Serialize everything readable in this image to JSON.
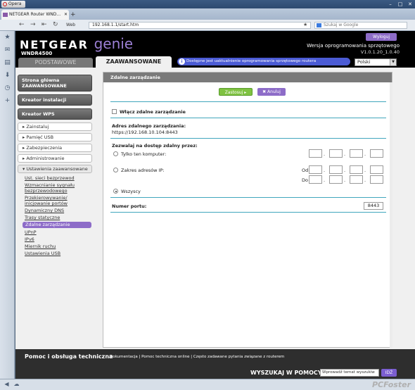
{
  "browser": {
    "menu_label": "Opera",
    "tab_title": "NETGEAR Router WND...",
    "web_label": "Web",
    "url": "192.168.1.1/start.htm",
    "search_placeholder": "Szukaj w Google",
    "watermark": "PCFoster"
  },
  "header": {
    "brand": "NETGEAR",
    "product": "genie",
    "model": "WNDR4500",
    "logout_label": "Wyloguj",
    "firmware_label": "Wersja oprogramowania sprzętowego",
    "firmware_version": "V1.0.1.20_1.0.40",
    "tab_basic": "PODSTAWOWE",
    "tab_advanced": "ZAAWANSOWANE",
    "update_notice": "Dostępne jest uaktualnienie oprogramowania sprzętowego routera",
    "language": "Polski"
  },
  "menu": {
    "home": "Strona główna ZAAWANSOWANE",
    "setup_wizard": "Kreator instalacji",
    "wps_wizard": "Kreator WPS",
    "sections": [
      "Zainstaluj",
      "Pamięć USB",
      "Zabezpieczenia",
      "Administrowanie",
      "Ustawienia zaawansowane"
    ],
    "subitems": [
      "Ust. sieci bezprzewod",
      "Wzmacnianie sygnału bezprzewodowego",
      "Przekierowywanie/ inicjowanie portów",
      "Dynamiczny DNS",
      "Trasy statyczne",
      "Zdalne zarządzanie",
      "UPnP",
      "IPv6",
      "Miernik ruchu",
      "Ustawienia USB"
    ]
  },
  "content": {
    "title": "Zdalne zarządzanie",
    "apply_label": "Zastosuj",
    "cancel_label": "Anuluj",
    "enable_label": "Włącz zdalne zarządzanie",
    "address_label": "Adres zdalnego zarządzania:",
    "address_value": "https://192.168.10.104:8443",
    "allow_label": "Zezwalaj na dostęp zdalny przez:",
    "only_this": "Tylko ten komputer:",
    "ip_range": "Zakres adresów IP:",
    "from_label": "Od",
    "to_label": "Do",
    "everyone": "Wszyscy",
    "port_label": "Numer portu:",
    "port_value": "8443"
  },
  "footer": {
    "help_title": "Pomoc i obsługa techniczna",
    "links": "Dokumentacja | Pomoc techniczna online | Często zadawane pytania związane z routerem",
    "search_label": "WYSZUKAJ W POMOCY",
    "search_placeholder": "Wprowadź temat wyszukiw",
    "search_button": "IDŹ"
  }
}
